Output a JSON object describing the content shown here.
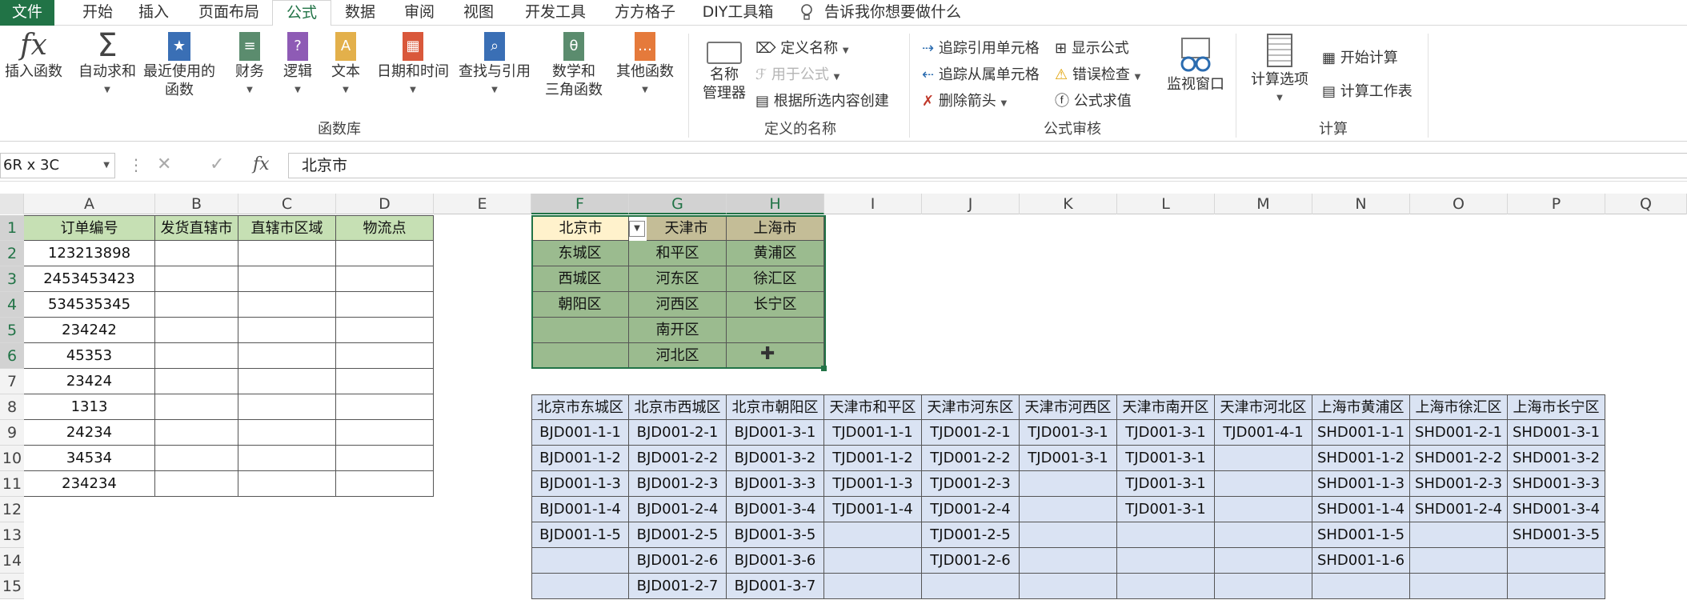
{
  "ribbon_tabs": [
    "文件",
    "开始",
    "插入",
    "页面布局",
    "公式",
    "数据",
    "审阅",
    "视图",
    "开发工具",
    "方方格子",
    "DIY工具箱"
  ],
  "tell_me": "告诉我你想要做什么",
  "function_library": {
    "buttons": [
      "插入函数",
      "自动求和",
      "最近使用的\n函数",
      "财务",
      "逻辑",
      "文本",
      "日期和时间",
      "查找与引用",
      "数学和\n三角函数",
      "其他函数"
    ],
    "group_label": "函数库"
  },
  "defined_names": {
    "name_manager": "名称\n管理器",
    "define_name": "定义名称",
    "use_in_formula": "用于公式",
    "create_from_selection": "根据所选内容创建",
    "group_label": "定义的名称"
  },
  "formula_auditing": {
    "trace_precedents": "追踪引用单元格",
    "trace_dependents": "追踪从属单元格",
    "remove_arrows": "删除箭头",
    "show_formulas": "显示公式",
    "error_checking": "错误检查",
    "evaluate_formula": "公式求值",
    "watch_window": "监视窗口",
    "group_label": "公式审核"
  },
  "calculation": {
    "options": "计算选项",
    "calc_now": "开始计算",
    "calc_sheet": "计算工作表",
    "group_label": "计算"
  },
  "name_box": "6R x 3C",
  "formula_value": "北京市",
  "columns": [
    "A",
    "B",
    "C",
    "D",
    "E",
    "F",
    "G",
    "H",
    "I",
    "J",
    "K",
    "L",
    "M",
    "N",
    "O",
    "P",
    "Q"
  ],
  "rows": [
    "1",
    "2",
    "3",
    "4",
    "5",
    "6",
    "7",
    "8",
    "9",
    "10",
    "11",
    "12",
    "13",
    "14",
    "15"
  ],
  "order_table": {
    "headers": [
      "订单编号",
      "发货直辖市",
      "直辖市区域",
      "物流点"
    ],
    "order_ids": [
      "123213898",
      "2453453423",
      "534535345",
      "234242",
      "45353",
      "23424",
      "1313",
      "24234",
      "34534",
      "234234"
    ]
  },
  "city_table": {
    "headers": [
      "北京市",
      "天津市",
      "上海市"
    ],
    "rows": [
      [
        "东城区",
        "和平区",
        "黄浦区"
      ],
      [
        "西城区",
        "河东区",
        "徐汇区"
      ],
      [
        "朝阳区",
        "河西区",
        "长宁区"
      ],
      [
        "",
        "南开区",
        ""
      ],
      [
        "",
        "河北区",
        ""
      ]
    ]
  },
  "logistics_table": {
    "headers": [
      "北京市东城区",
      "北京市西城区",
      "北京市朝阳区",
      "天津市和平区",
      "天津市河东区",
      "天津市河西区",
      "天津市南开区",
      "天津市河北区",
      "上海市黄浦区",
      "上海市徐汇区",
      "上海市长宁区"
    ],
    "rows": [
      [
        "BJD001-1-1",
        "BJD001-2-1",
        "BJD001-3-1",
        "TJD001-1-1",
        "TJD001-2-1",
        "TJD001-3-1",
        "TJD001-3-1",
        "TJD001-4-1",
        "SHD001-1-1",
        "SHD001-2-1",
        "SHD001-3-1"
      ],
      [
        "BJD001-1-2",
        "BJD001-2-2",
        "BJD001-3-2",
        "TJD001-1-2",
        "TJD001-2-2",
        "TJD001-3-1",
        "TJD001-3-1",
        "",
        "SHD001-1-2",
        "SHD001-2-2",
        "SHD001-3-2"
      ],
      [
        "BJD001-1-3",
        "BJD001-2-3",
        "BJD001-3-3",
        "TJD001-1-3",
        "TJD001-2-3",
        "",
        "TJD001-3-1",
        "",
        "SHD001-1-3",
        "SHD001-2-3",
        "SHD001-3-3"
      ],
      [
        "BJD001-1-4",
        "BJD001-2-4",
        "BJD001-3-4",
        "TJD001-1-4",
        "TJD001-2-4",
        "",
        "TJD001-3-1",
        "",
        "SHD001-1-4",
        "SHD001-2-4",
        "SHD001-3-4"
      ],
      [
        "BJD001-1-5",
        "BJD001-2-5",
        "BJD001-3-5",
        "",
        "TJD001-2-5",
        "",
        "",
        "",
        "SHD001-1-5",
        "",
        "SHD001-3-5"
      ],
      [
        "",
        "BJD001-2-6",
        "BJD001-3-6",
        "",
        "TJD001-2-6",
        "",
        "",
        "",
        "SHD001-1-6",
        "",
        ""
      ],
      [
        "",
        "BJD001-2-7",
        "BJD001-3-7",
        "",
        "",
        "",
        "",
        "",
        "",
        "",
        ""
      ]
    ]
  },
  "colors": {
    "excel_green": "#217346",
    "order_header": "#c6e0b4",
    "map_cells": "#9bbb8f",
    "map_header": "#c4bd97",
    "blue_table": "#dae3f3"
  }
}
